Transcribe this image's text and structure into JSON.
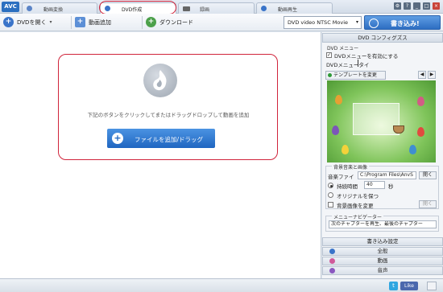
{
  "app": {
    "logo": "AVC"
  },
  "tabs": [
    {
      "label": "動画変換",
      "icon": "convert-icon",
      "color": "#5b84c7"
    },
    {
      "label": "DVD作成",
      "icon": "dvd-icon",
      "color": "#3a74c9"
    },
    {
      "label": "録画",
      "icon": "record-icon",
      "color": "#666666"
    },
    {
      "label": "動画再生",
      "icon": "play-icon",
      "color": "#3a74c9"
    }
  ],
  "window_controls": [
    "?",
    "_",
    "□",
    "×"
  ],
  "toolbar": {
    "open_dvd": "DVDを開く",
    "add_video": "動画追加",
    "download": "ダウンロード",
    "format": "DVD video NTSC Movie",
    "burn": "書き込み!"
  },
  "main": {
    "hint": "下記のボタンをクリックしてまたはドラッグドロップして動画を追加",
    "add_button": "ファイルを追加/ドラッグ"
  },
  "panel": {
    "title": "DVD コンフィグズス",
    "menu_group": "DVD メニュー",
    "enable_menu": "DVDメニューを有効にする",
    "enable_menu_checked": true,
    "menu_title_label": "DVDメニュータイ",
    "template_button": "テンプレートを変更",
    "bg_group": "背景音楽と画像",
    "music_file_label": "音楽ファイ",
    "music_file_value": "C:\\Program Files\\AnvS",
    "open_button": "開く",
    "duration_label": "持続時間",
    "duration_value": "40",
    "duration_unit": "秒",
    "keep_original": "オリジナルを保つ",
    "bg_image": "背景画像を変更",
    "open_button2": "開く",
    "navigator_group": "メニューナビゲーター",
    "navigator_value": "次のチャプターを再生、最後のチャプター"
  },
  "accordion": [
    {
      "label": "書き込み設定",
      "color": ""
    },
    {
      "label": "全般",
      "color": "#3a74c9"
    },
    {
      "label": "動画",
      "color": "#d05a9a"
    },
    {
      "label": "音声",
      "color": "#8a58c0"
    }
  ],
  "status": {
    "twitter": "t",
    "facebook": "Like"
  }
}
